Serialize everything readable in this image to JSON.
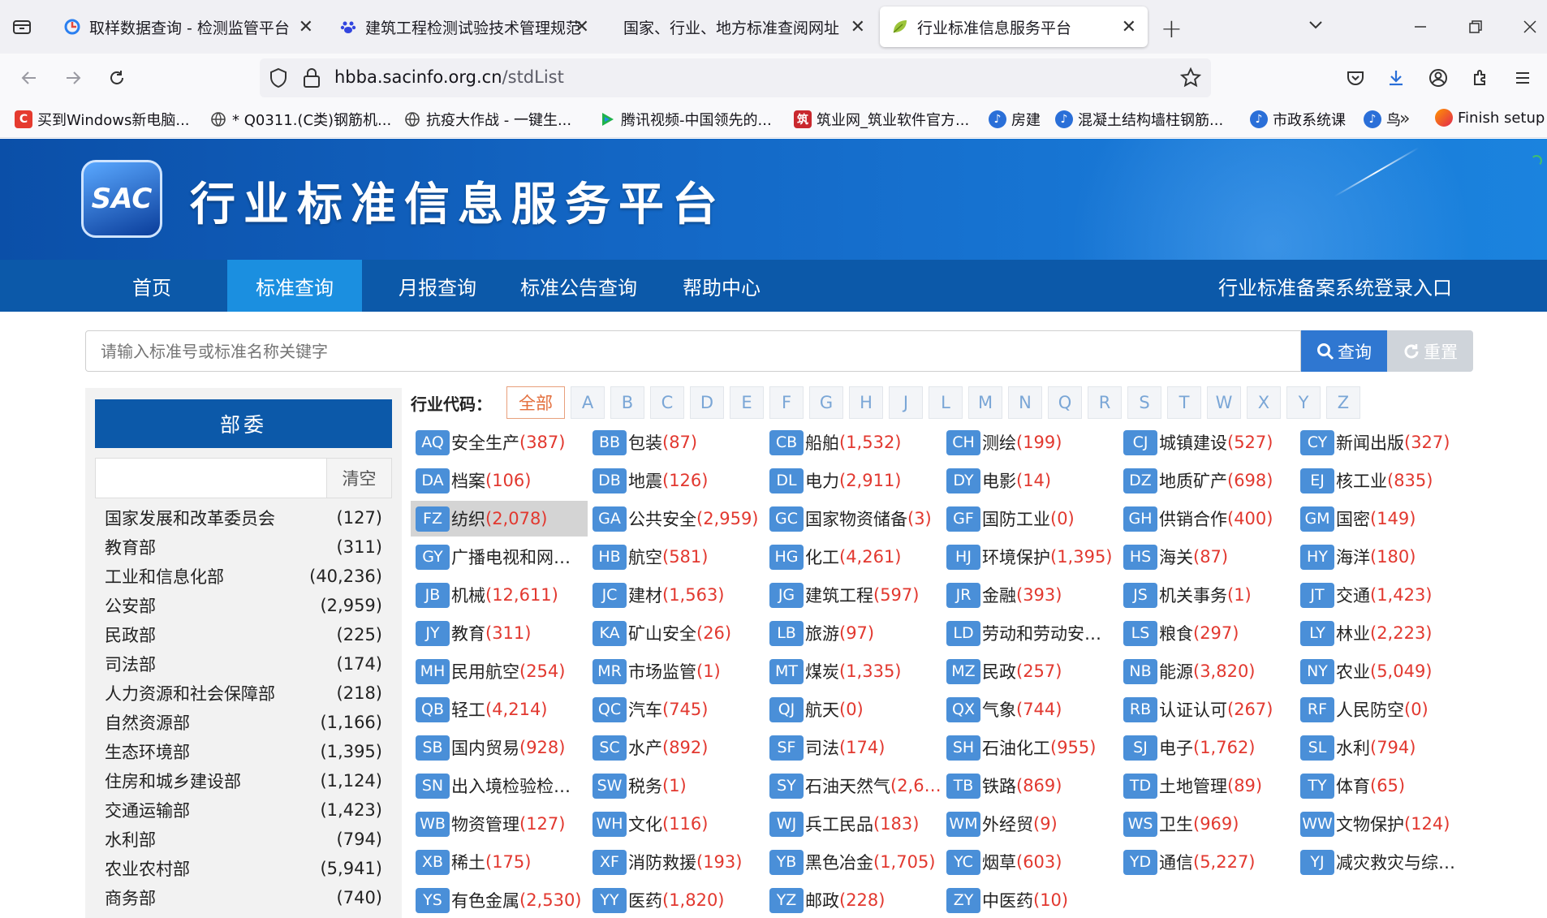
{
  "browser": {
    "tabs": [
      {
        "title": "取样数据查询 - 检测监管平台",
        "active": false
      },
      {
        "title": "建筑工程检测试验技术管理规范",
        "active": false
      },
      {
        "title": "国家、行业、地方标准查阅网址",
        "active": false
      },
      {
        "title": "行业标准信息服务平台",
        "active": true
      }
    ],
    "url_domain": "hbba.sacinfo.org.cn",
    "url_path": "/stdList",
    "bookmarks": [
      "买到Windows新电脑...",
      "* Q0311.(C类)钢筋机...",
      "抗疫大作战 - 一键生...",
      "腾讯视频-中国领先的...",
      "筑业网_筑业软件官方...",
      "房建",
      "混凝土结构墙柱钢筋...",
      "市政系统课",
      "鸟",
      "Finish setup"
    ]
  },
  "page": {
    "logo_text": "SAC",
    "site_title": "行业标准信息服务平台",
    "nav": [
      "首页",
      "标准查询",
      "月报查询",
      "标准公告查询",
      "帮助中心"
    ],
    "nav_active": 1,
    "nav_right": "行业标准备案系统登录入口",
    "search": {
      "placeholder": "请输入标准号或标准名称关键字",
      "search_label": "查询",
      "reset_label": "重置"
    },
    "sidebar": {
      "title": "部委",
      "clear_label": "清空",
      "items": [
        {
          "name": "国家发展和改革委员会",
          "count": "(127)"
        },
        {
          "name": "教育部",
          "count": "(311)"
        },
        {
          "name": "工业和信息化部",
          "count": "(40,236)"
        },
        {
          "name": "公安部",
          "count": "(2,959)"
        },
        {
          "name": "民政部",
          "count": "(225)"
        },
        {
          "name": "司法部",
          "count": "(174)"
        },
        {
          "name": "人力资源和社会保障部",
          "count": "(218)"
        },
        {
          "name": "自然资源部",
          "count": "(1,166)"
        },
        {
          "name": "生态环境部",
          "count": "(1,395)"
        },
        {
          "name": "住房和城乡建设部",
          "count": "(1,124)"
        },
        {
          "name": "交通运输部",
          "count": "(1,423)"
        },
        {
          "name": "水利部",
          "count": "(794)"
        },
        {
          "name": "农业农村部",
          "count": "(5,941)"
        },
        {
          "name": "商务部",
          "count": "(740)"
        }
      ]
    },
    "industry": {
      "label": "行业代码：",
      "letters": [
        "全部",
        "A",
        "B",
        "C",
        "D",
        "E",
        "F",
        "G",
        "H",
        "J",
        "L",
        "M",
        "N",
        "Q",
        "R",
        "S",
        "T",
        "W",
        "X",
        "Y",
        "Z"
      ],
      "selected_code": "FZ",
      "codes": [
        {
          "code": "AQ",
          "name": "安全生产",
          "count": "(387)"
        },
        {
          "code": "BB",
          "name": "包装",
          "count": "(87)"
        },
        {
          "code": "CB",
          "name": "船舶",
          "count": "(1,532)"
        },
        {
          "code": "CH",
          "name": "测绘",
          "count": "(199)"
        },
        {
          "code": "CJ",
          "name": "城镇建设",
          "count": "(527)"
        },
        {
          "code": "CY",
          "name": "新闻出版",
          "count": "(327)"
        },
        {
          "code": "DA",
          "name": "档案",
          "count": "(106)"
        },
        {
          "code": "DB",
          "name": "地震",
          "count": "(126)"
        },
        {
          "code": "DL",
          "name": "电力",
          "count": "(2,911)"
        },
        {
          "code": "DY",
          "name": "电影",
          "count": "(14)"
        },
        {
          "code": "DZ",
          "name": "地质矿产",
          "count": "(698)"
        },
        {
          "code": "EJ",
          "name": "核工业",
          "count": "(835)"
        },
        {
          "code": "FZ",
          "name": "纺织",
          "count": "(2,078)"
        },
        {
          "code": "GA",
          "name": "公共安全",
          "count": "(2,959)"
        },
        {
          "code": "GC",
          "name": "国家物资储备",
          "count": "(3)"
        },
        {
          "code": "GF",
          "name": "国防工业",
          "count": "(0)"
        },
        {
          "code": "GH",
          "name": "供销合作",
          "count": "(400)"
        },
        {
          "code": "GM",
          "name": "国密",
          "count": "(149)"
        },
        {
          "code": "GY",
          "name": "广播电视和网…",
          "count": ""
        },
        {
          "code": "HB",
          "name": "航空",
          "count": "(581)"
        },
        {
          "code": "HG",
          "name": "化工",
          "count": "(4,261)"
        },
        {
          "code": "HJ",
          "name": "环境保护",
          "count": "(1,395)"
        },
        {
          "code": "HS",
          "name": "海关",
          "count": "(87)"
        },
        {
          "code": "HY",
          "name": "海洋",
          "count": "(180)"
        },
        {
          "code": "JB",
          "name": "机械",
          "count": "(12,611)"
        },
        {
          "code": "JC",
          "name": "建材",
          "count": "(1,563)"
        },
        {
          "code": "JG",
          "name": "建筑工程",
          "count": "(597)"
        },
        {
          "code": "JR",
          "name": "金融",
          "count": "(393)"
        },
        {
          "code": "JS",
          "name": "机关事务",
          "count": "(1)"
        },
        {
          "code": "JT",
          "name": "交通",
          "count": "(1,423)"
        },
        {
          "code": "JY",
          "name": "教育",
          "count": "(311)"
        },
        {
          "code": "KA",
          "name": "矿山安全",
          "count": "(26)"
        },
        {
          "code": "LB",
          "name": "旅游",
          "count": "(97)"
        },
        {
          "code": "LD",
          "name": "劳动和劳动安…",
          "count": ""
        },
        {
          "code": "LS",
          "name": "粮食",
          "count": "(297)"
        },
        {
          "code": "LY",
          "name": "林业",
          "count": "(2,223)"
        },
        {
          "code": "MH",
          "name": "民用航空",
          "count": "(254)"
        },
        {
          "code": "MR",
          "name": "市场监管",
          "count": "(1)"
        },
        {
          "code": "MT",
          "name": "煤炭",
          "count": "(1,335)"
        },
        {
          "code": "MZ",
          "name": "民政",
          "count": "(257)"
        },
        {
          "code": "NB",
          "name": "能源",
          "count": "(3,820)"
        },
        {
          "code": "NY",
          "name": "农业",
          "count": "(5,049)"
        },
        {
          "code": "QB",
          "name": "轻工",
          "count": "(4,214)"
        },
        {
          "code": "QC",
          "name": "汽车",
          "count": "(745)"
        },
        {
          "code": "QJ",
          "name": "航天",
          "count": "(0)"
        },
        {
          "code": "QX",
          "name": "气象",
          "count": "(744)"
        },
        {
          "code": "RB",
          "name": "认证认可",
          "count": "(267)"
        },
        {
          "code": "RF",
          "name": "人民防空",
          "count": "(0)"
        },
        {
          "code": "SB",
          "name": "国内贸易",
          "count": "(928)"
        },
        {
          "code": "SC",
          "name": "水产",
          "count": "(892)"
        },
        {
          "code": "SF",
          "name": "司法",
          "count": "(174)"
        },
        {
          "code": "SH",
          "name": "石油化工",
          "count": "(955)"
        },
        {
          "code": "SJ",
          "name": "电子",
          "count": "(1,762)"
        },
        {
          "code": "SL",
          "name": "水利",
          "count": "(794)"
        },
        {
          "code": "SN",
          "name": "出入境检验检…",
          "count": ""
        },
        {
          "code": "SW",
          "name": "税务",
          "count": "(1)"
        },
        {
          "code": "SY",
          "name": "石油天然气",
          "count": "(2,6…"
        },
        {
          "code": "TB",
          "name": "铁路",
          "count": "(869)"
        },
        {
          "code": "TD",
          "name": "土地管理",
          "count": "(89)"
        },
        {
          "code": "TY",
          "name": "体育",
          "count": "(65)"
        },
        {
          "code": "WB",
          "name": "物资管理",
          "count": "(127)"
        },
        {
          "code": "WH",
          "name": "文化",
          "count": "(116)"
        },
        {
          "code": "WJ",
          "name": "兵工民品",
          "count": "(183)"
        },
        {
          "code": "WM",
          "name": "外经贸",
          "count": "(9)"
        },
        {
          "code": "WS",
          "name": "卫生",
          "count": "(969)"
        },
        {
          "code": "WW",
          "name": "文物保护",
          "count": "(124)"
        },
        {
          "code": "XB",
          "name": "稀土",
          "count": "(175)"
        },
        {
          "code": "XF",
          "name": "消防救援",
          "count": "(193)"
        },
        {
          "code": "YB",
          "name": "黑色冶金",
          "count": "(1,705)"
        },
        {
          "code": "YC",
          "name": "烟草",
          "count": "(603)"
        },
        {
          "code": "YD",
          "name": "通信",
          "count": "(5,227)"
        },
        {
          "code": "YJ",
          "name": "减灾救灾与综…",
          "count": ""
        },
        {
          "code": "YS",
          "name": "有色金属",
          "count": "(2,530)"
        },
        {
          "code": "YY",
          "name": "医药",
          "count": "(1,820)"
        },
        {
          "code": "YZ",
          "name": "邮政",
          "count": "(228)"
        },
        {
          "code": "ZY",
          "name": "中医药",
          "count": "(10)"
        }
      ]
    }
  },
  "colors": {
    "brand_blue": "#0c59a9",
    "nav_active": "#1b8fe0",
    "code_badge": "#4a8fd8",
    "count_red": "#e2382f",
    "letter_active": "#e36e3c"
  }
}
